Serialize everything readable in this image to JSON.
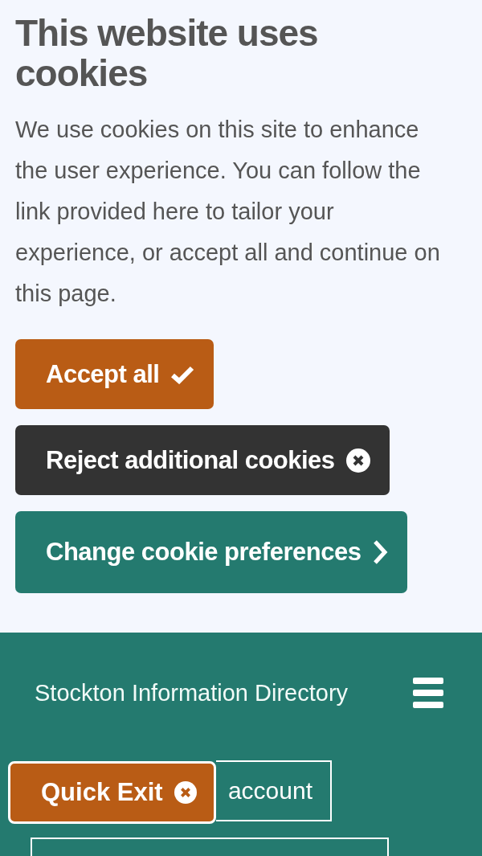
{
  "banner": {
    "title": "This website uses cookies",
    "body": "We use cookies on this site to enhance the user experience. You can follow the link provided here to tailor your experience, or accept all and continue on this page.",
    "buttons": [
      {
        "kind": "accept",
        "label": "Accept all"
      },
      {
        "kind": "reject",
        "label": "Reject additional cookies"
      },
      {
        "kind": "preferences",
        "label": "Change cookie preferences"
      }
    ]
  },
  "header": {
    "site_name": "Stockton Information Directory",
    "account_button": "account",
    "quick_exit": "Quick Exit"
  }
}
